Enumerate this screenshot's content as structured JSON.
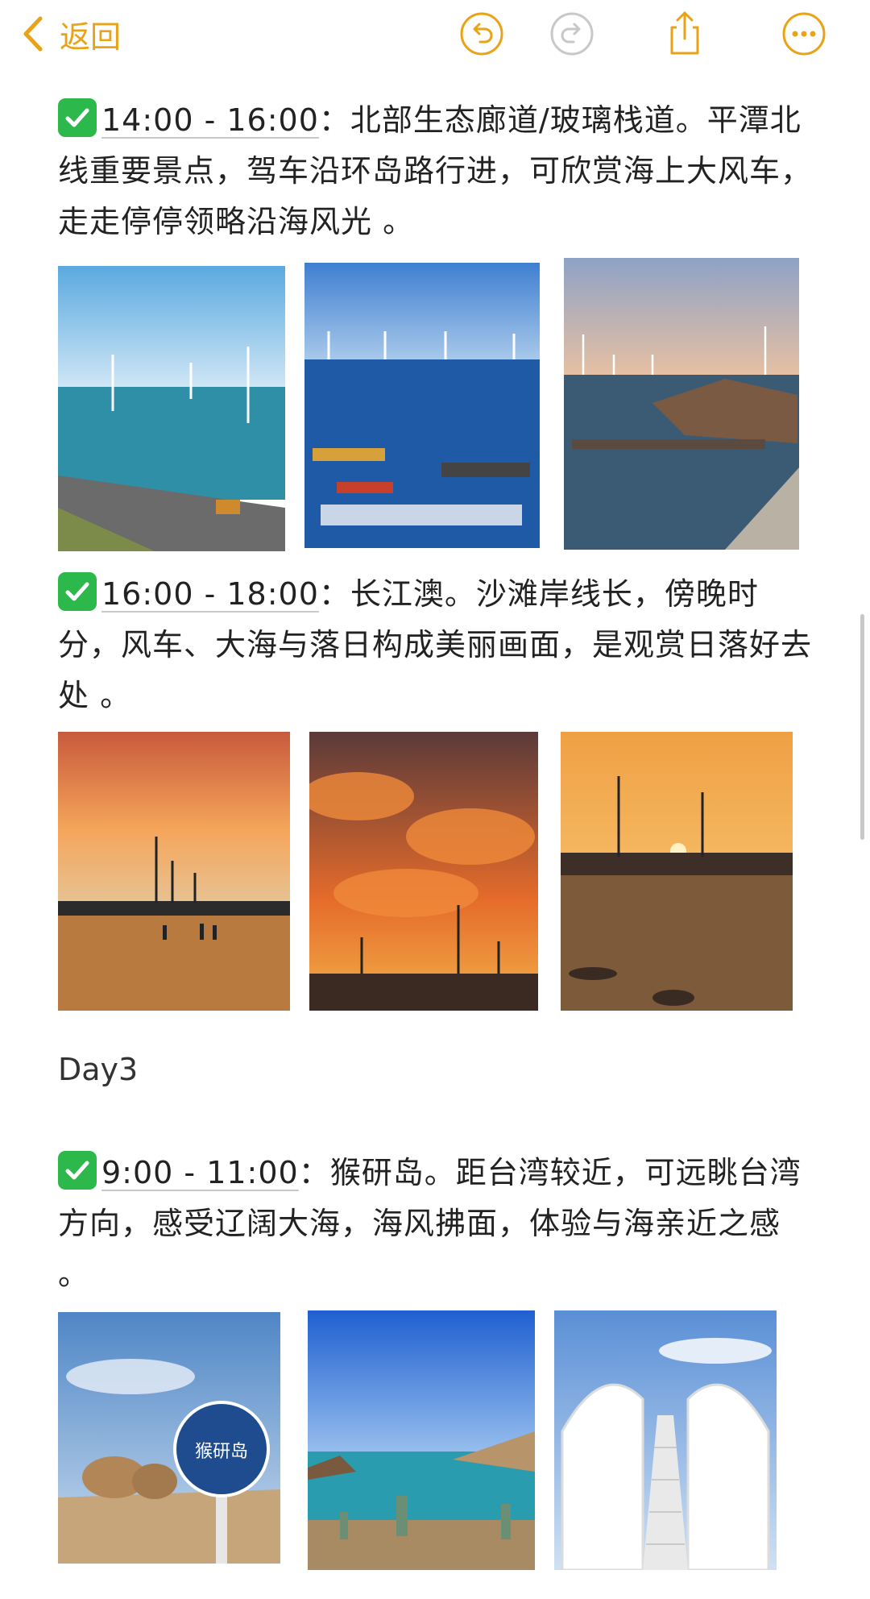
{
  "nav": {
    "back_label": "返回",
    "accent_color": "#E8A317",
    "icons": [
      "chevron-left-icon",
      "undo-icon",
      "redo-icon",
      "share-icon",
      "more-icon"
    ]
  },
  "sections": [
    {
      "time": "14:00 - 16:00",
      "text": "：北部生态廊道/玻璃栈道。平潭北线重要景点，驾车沿环岛路行进，可欣赏海上大风车，走走停停领略沿海风光 。",
      "photos": [
        "windmills-coastal-road-photo",
        "fishing-boats-harbor-photo",
        "rocky-pier-windmills-photo"
      ]
    },
    {
      "time": "16:00 - 18:00",
      "text": "：长江澳。沙滩岸线长，傍晚时分，风车、大海与落日构成美丽画面，是观赏日落好去处 。",
      "photos": [
        "sunset-beach-windmills-photo",
        "fiery-clouds-sunset-photo",
        "sun-on-horizon-photo"
      ]
    },
    {
      "time": "9:00 - 11:00",
      "text": "：猴研岛。距台湾较近，可远眺台湾方向，感受辽阔大海，海风拂面，体验与海亲近之感 。",
      "photos": [
        "houyan-island-sign-photo",
        "blue-sea-coast-photo",
        "white-arch-bridge-photo"
      ]
    }
  ],
  "day_label": "Day3",
  "sign_text": "猴研岛"
}
